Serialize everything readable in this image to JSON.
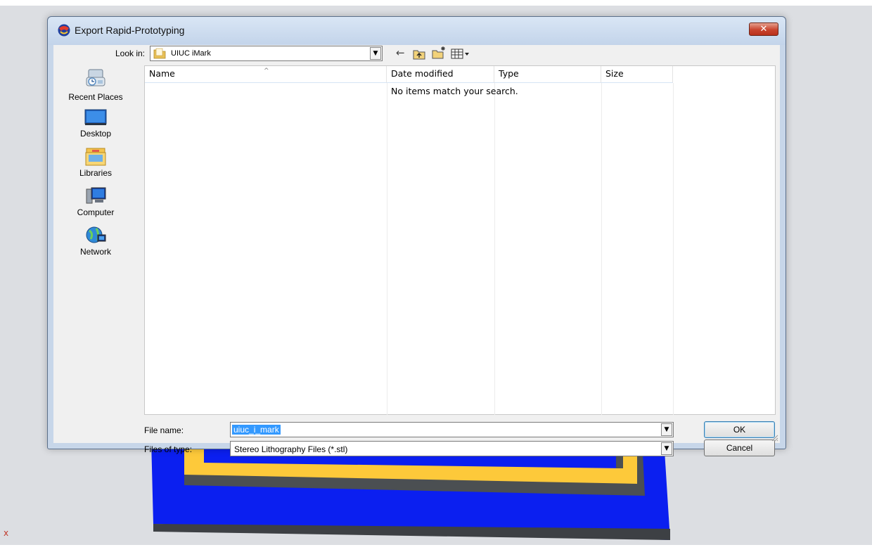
{
  "window": {
    "title": "Export Rapid-Prototyping",
    "close_label": "✕"
  },
  "toolbar": {
    "look_in_label": "Look in:",
    "look_in_value": "UIUC iMark",
    "icons": [
      "back-arrow-icon",
      "up-folder-icon",
      "new-folder-icon",
      "view-menu-icon"
    ]
  },
  "places": [
    {
      "label": "Recent Places",
      "icon": "recent-places-icon"
    },
    {
      "label": "Desktop",
      "icon": "desktop-icon"
    },
    {
      "label": "Libraries",
      "icon": "libraries-icon"
    },
    {
      "label": "Computer",
      "icon": "computer-icon"
    },
    {
      "label": "Network",
      "icon": "network-icon"
    }
  ],
  "file_list": {
    "columns": [
      "Name",
      "Date modified",
      "Type",
      "Size"
    ],
    "empty_message": "No items match your search."
  },
  "file_name": {
    "label": "File name:",
    "value": "uiuc_i_mark"
  },
  "file_type": {
    "label": "Files of type:",
    "value": "Stereo Lithography Files (*.stl)"
  },
  "buttons": {
    "ok": "OK",
    "cancel": "Cancel"
  },
  "background": {
    "corner_mark": "x"
  },
  "colors": {
    "cad_blue": "#0b1ff0",
    "cad_yellow": "#fdc93a",
    "cad_gray": "#4b4f52",
    "selection": "#3399ff"
  }
}
